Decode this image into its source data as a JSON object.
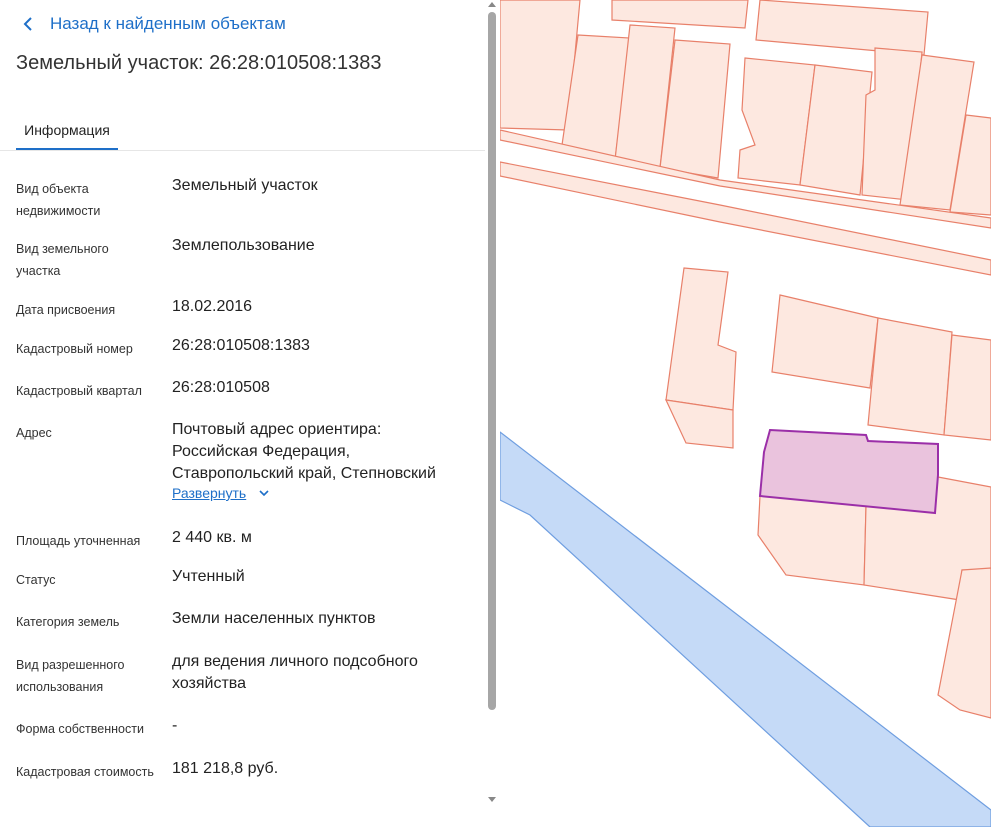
{
  "panel": {
    "back_label": "Назад к найденным объектам",
    "title": "Земельный участок: 26:28:010508:1383",
    "tab_info": "Информация",
    "expand_label": "Развернуть"
  },
  "fields": {
    "object_type": {
      "label": "Вид объекта недвижимости",
      "value": "Земельный участок"
    },
    "land_type": {
      "label": "Вид земельного участка",
      "value": "Землепользование"
    },
    "assign_date": {
      "label": "Дата присвоения",
      "value": "18.02.2016"
    },
    "cadastral_number": {
      "label": "Кадастровый номер",
      "value": "26:28:010508:1383"
    },
    "cadastral_quarter": {
      "label": "Кадастровый квартал",
      "value": "26:28:010508"
    },
    "address": {
      "label": "Адрес",
      "lines": [
        "Почтовый адрес ориентира:",
        "Российская Федерация,",
        "Ставропольский край, Степновский"
      ]
    },
    "area": {
      "label": "Площадь уточненная",
      "value": "2 440 кв. м"
    },
    "status": {
      "label": "Статус",
      "value": "Учтенный"
    },
    "land_category": {
      "label": "Категория земель",
      "value": "Земли населенных пунктов"
    },
    "permitted_use": {
      "label": "Вид разрешенного использования",
      "value": "для ведения личного подсобного хозяйства"
    },
    "ownership": {
      "label": "Форма собственности",
      "value": "-"
    },
    "cadastral_value": {
      "label": "Кадастровая стоимость",
      "value": "181 218,8 руб."
    }
  },
  "colors": {
    "accent": "#1e6fc8",
    "parcel_fill": "#fde8e0",
    "parcel_stroke": "#e8806a",
    "selected_fill": "#eac3dd",
    "selected_stroke": "#9b2fa8",
    "water_fill": "#c5daf7",
    "water_stroke": "#6f9ee0"
  },
  "icons": {
    "back": "chevron-left-icon",
    "expand": "chevron-down-icon",
    "scroll_up": "scroll-up-arrow-icon",
    "scroll_down": "scroll-down-arrow-icon"
  }
}
